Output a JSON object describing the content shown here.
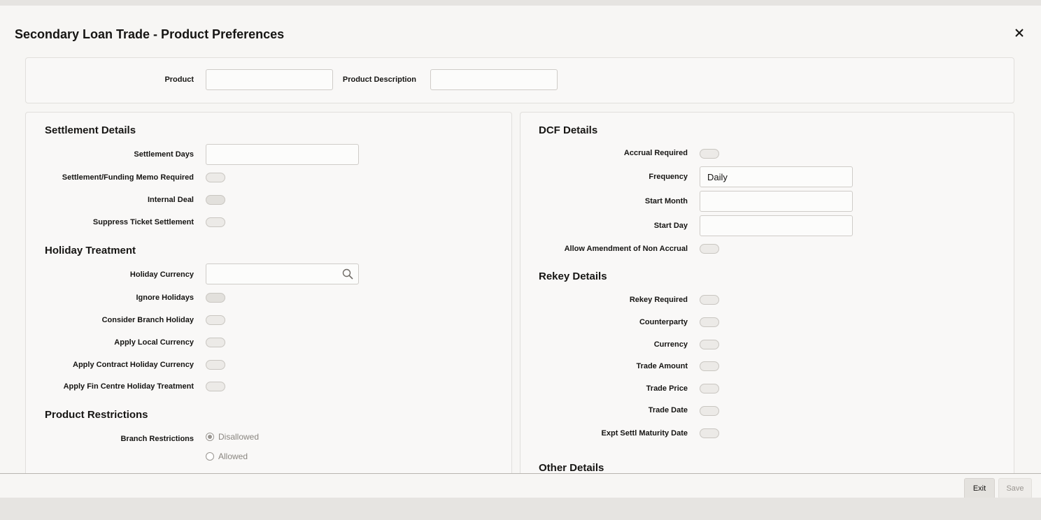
{
  "window": {
    "title": "Secondary Loan Trade - Product Preferences",
    "close_icon": "close-icon"
  },
  "product": {
    "product_label": "Product",
    "product_value": "",
    "description_label": "Product Description",
    "description_value": ""
  },
  "settlement": {
    "heading": "Settlement Details",
    "days_label": "Settlement Days",
    "days_value": "",
    "memo_label": "Settlement/Funding Memo Required",
    "internal_label": "Internal Deal",
    "suppress_label": "Suppress Ticket Settlement"
  },
  "holiday": {
    "heading": "Holiday Treatment",
    "currency_label": "Holiday Currency",
    "currency_value": "",
    "ignore_label": "Ignore Holidays",
    "branch_label": "Consider Branch Holiday",
    "local_label": "Apply Local Currency",
    "contract_label": "Apply Contract Holiday Currency",
    "fincentre_label": "Apply Fin Centre Holiday Treatment"
  },
  "restrictions": {
    "heading": "Product Restrictions",
    "branch_label": "Branch Restrictions",
    "options": [
      "Disallowed",
      "Allowed"
    ],
    "selected": "Disallowed"
  },
  "dcf": {
    "heading": "DCF Details",
    "accrual_label": "Accrual Required",
    "frequency_label": "Frequency",
    "frequency_value": "Daily",
    "start_month_label": "Start Month",
    "start_month_value": "",
    "start_day_label": "Start Day",
    "start_day_value": "",
    "amend_label": "Allow Amendment of Non Accrual"
  },
  "rekey": {
    "heading": "Rekey Details",
    "required_label": "Rekey Required",
    "counterparty_label": "Counterparty",
    "currency_label": "Currency",
    "amount_label": "Trade Amount",
    "price_label": "Trade Price",
    "date_label": "Trade Date",
    "maturity_label": "Expt Settl Maturity Date"
  },
  "other": {
    "heading": "Other Details"
  },
  "footer": {
    "exit_label": "Exit",
    "save_label": "Save"
  },
  "colors": {
    "background": "#f7f6f4",
    "toggle_border": "#c9c6c1",
    "text": "#161513"
  }
}
